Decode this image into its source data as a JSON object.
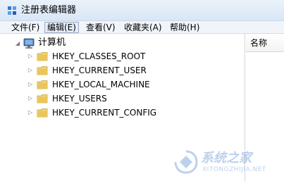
{
  "window": {
    "title": "注册表编辑器"
  },
  "menubar": {
    "items": [
      {
        "label": "文件(F)"
      },
      {
        "label": "编辑(E)",
        "active": true
      },
      {
        "label": "查看(V)"
      },
      {
        "label": "收藏夹(A)"
      },
      {
        "label": "帮助(H)"
      }
    ]
  },
  "tree": {
    "root": {
      "label": "计算机",
      "expanded": true,
      "icon": "computer-icon"
    },
    "children": [
      {
        "label": "HKEY_CLASSES_ROOT",
        "icon": "folder-icon"
      },
      {
        "label": "HKEY_CURRENT_USER",
        "icon": "folder-icon"
      },
      {
        "label": "HKEY_LOCAL_MACHINE",
        "icon": "folder-icon"
      },
      {
        "label": "HKEY_USERS",
        "icon": "folder-icon"
      },
      {
        "label": "HKEY_CURRENT_CONFIG",
        "icon": "folder-icon"
      }
    ]
  },
  "right_pane": {
    "column_header": "名称"
  },
  "watermark": {
    "text": "系统之家",
    "url": "XITONGZHIJIA.NET"
  },
  "colors": {
    "titlebar": "#dce8f6",
    "menubar": "#f1f5fb",
    "folder": "#e9c65a",
    "watermark": "#3f7ed0"
  }
}
